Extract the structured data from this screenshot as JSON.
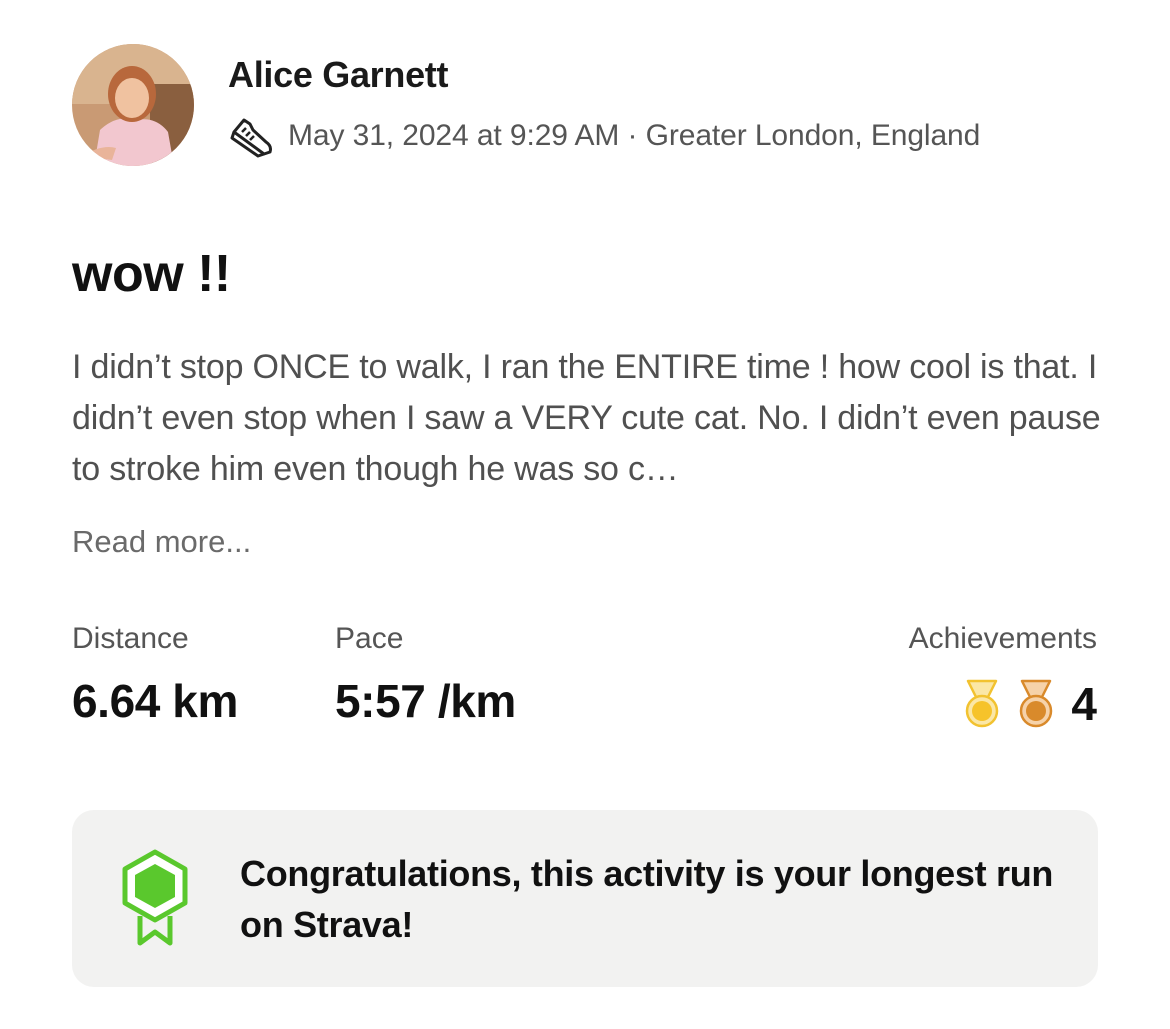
{
  "athlete": {
    "name": "Alice Garnett",
    "avatar_icon": "athlete-avatar-photo"
  },
  "meta": {
    "activity_icon": "running-shoe-icon",
    "text": "May 31, 2024 at 9:29 AM · Greater London, England"
  },
  "activity": {
    "title": "wow !!",
    "description": "I didn’t stop ONCE to walk, I ran the ENTIRE time ! how cool is that. I didn’t even stop when I saw a VERY cute cat. No. I didn’t even pause to stroke him even though he was so c…",
    "read_more_label": "Read more..."
  },
  "stats": {
    "distance": {
      "label": "Distance",
      "value": "6.64 km"
    },
    "pace": {
      "label": "Pace",
      "value": "5:57 /km"
    },
    "achievements": {
      "label": "Achievements",
      "icons": [
        "gold-medal-icon",
        "bronze-medal-icon"
      ],
      "count": "4"
    }
  },
  "banner": {
    "icon": "green-hexagon-badge-icon",
    "message": "Congratulations, this activity is your longest run on Strava!"
  },
  "colors": {
    "banner_background": "#f2f2f1",
    "badge_green": "#5ac82d",
    "gold_medal": "#f6c32a",
    "bronze_medal": "#d98a2b"
  }
}
